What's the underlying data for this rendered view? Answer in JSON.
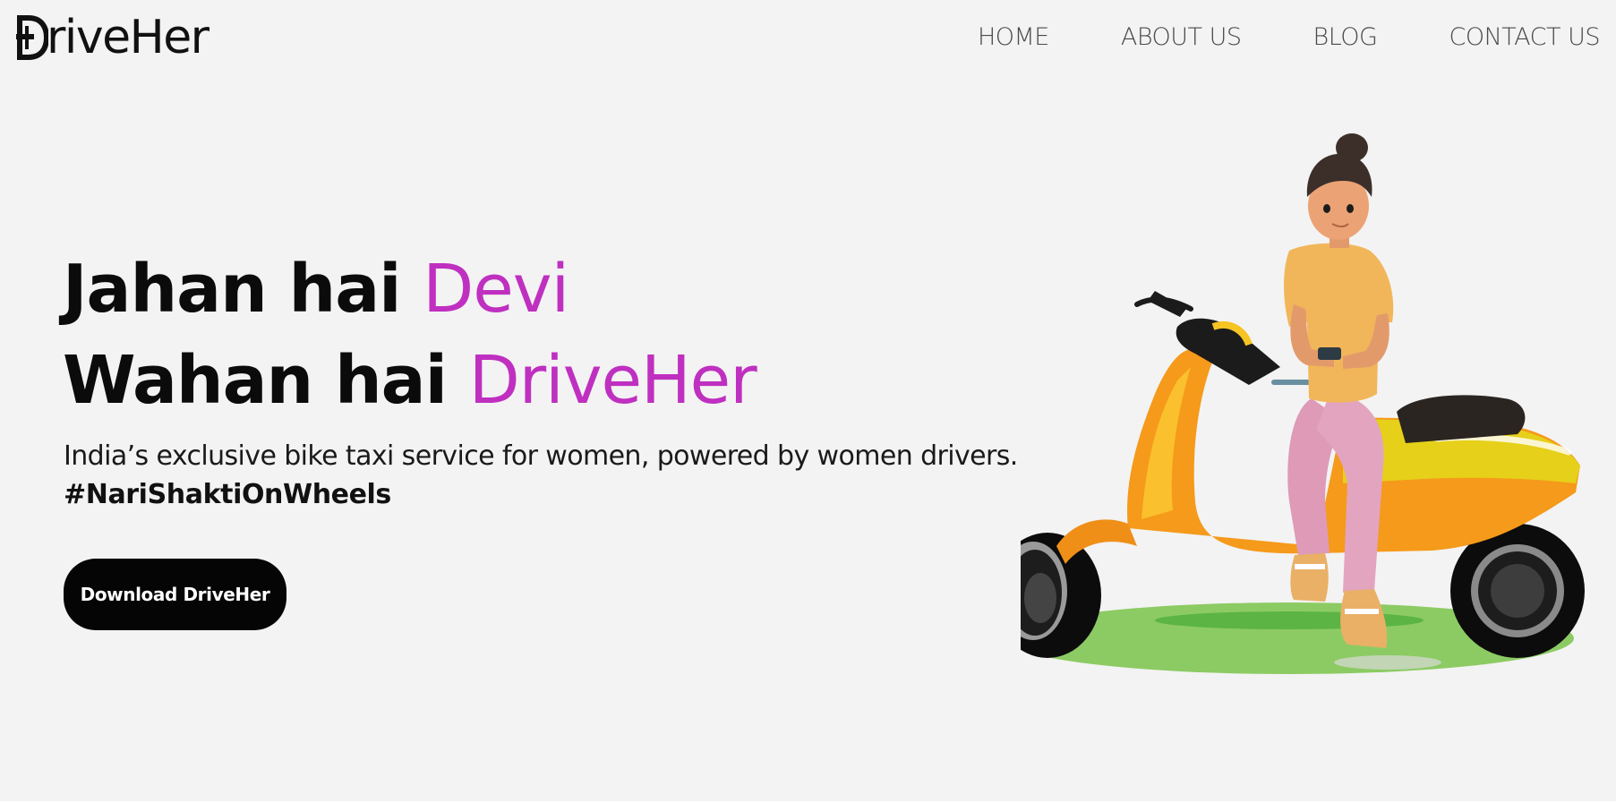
{
  "brand": {
    "name": "riveHer",
    "logo_letter": "D",
    "accent_color": "#bf30c0"
  },
  "nav": {
    "items": [
      {
        "label": "HOME"
      },
      {
        "label": "ABOUT US"
      },
      {
        "label": "BLOG"
      },
      {
        "label": "CONTACT US"
      }
    ]
  },
  "hero": {
    "line1_prefix": "Jahan hai ",
    "line1_accent": "Devi",
    "line2_prefix": "Wahan hai ",
    "line2_accent": "DriveHer",
    "subtitle": "India’s exclusive bike taxi service for women, powered by women drivers.",
    "hashtag": "#NariShaktiOnWheels",
    "cta_label": "Download DriveHer"
  },
  "illustration": {
    "icon": "woman-on-scooter-illustration"
  }
}
